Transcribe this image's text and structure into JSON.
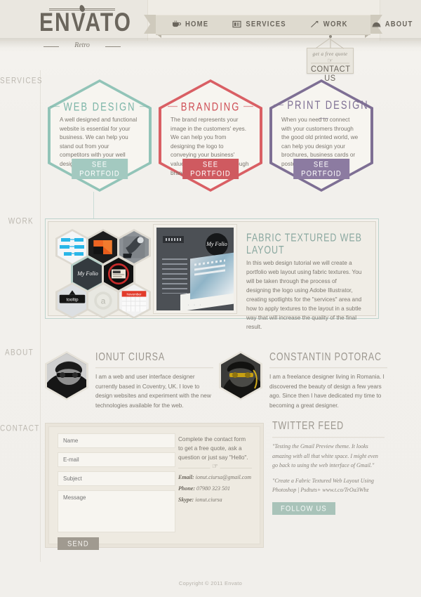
{
  "brand": {
    "name": "ENVATO",
    "tagline": "Retro",
    "bean_icon": "coffee-bean-icon"
  },
  "nav": {
    "items": [
      {
        "label": "HOME",
        "icon": "coffee-cup-icon"
      },
      {
        "label": "SERVICES",
        "icon": "book-icon"
      },
      {
        "label": "WORK",
        "icon": "hammer-icon"
      },
      {
        "label": "ABOUT",
        "icon": "hard-hat-icon"
      }
    ]
  },
  "contact_tag": {
    "quote": "get a free quote",
    "hand_icon": "pointing-hand-icon",
    "label": "CONTACT US"
  },
  "sidebar": {
    "labels": [
      "SERVICES",
      "WORK",
      "ABOUT",
      "CONTACT"
    ]
  },
  "services": [
    {
      "title": "WEB DESIGN",
      "body": "A well designed and functional website is essential for your business. We can help you stand out from your competitors with your well designed, custom website.",
      "button": "SEE PORTFOID",
      "color": "#92c4b8",
      "button_color": "#a3c9c0",
      "title_color": "#7cb5a8"
    },
    {
      "title": "BRANDING",
      "body": "The brand represents your image in the customers' eyes. We can help you from designing the logo to conveying your business' values and personality through branding.",
      "button": "SEE PORTFOID",
      "color": "#d95f64",
      "button_color": "#cf5a60",
      "title_color": "#cf4f56"
    },
    {
      "title": "PRINT DESIGN",
      "body": "When you need to connect with your customers through the good old printed world, we can help you design your brochures, business cards or posters.",
      "button": "SEE PORTFOID",
      "color": "#7e6f94",
      "button_color": "#8c7ba1",
      "title_color": "#7e6f94"
    }
  ],
  "work": {
    "title": "FABRIC TEXTURED WEB LAYOUT",
    "body": "In this web design tutorial we will create a portfolio web layout using fabric textures. You will be taken through the process of designing the logo using Adobe Illustrator, creating spotlights for the \"services\" area and how to apply textures to the layout in a subtle way that will increase the quality of the final result.",
    "thumbs": [
      {
        "name": "flowchart-thumb",
        "label": ""
      },
      {
        "name": "orange-cube-thumb",
        "label": ""
      },
      {
        "name": "gray-arm-thumb",
        "label": ""
      },
      {
        "name": "my-folio-thumb",
        "label": "My Folio"
      },
      {
        "name": "red-ring-thumb",
        "label": ""
      },
      {
        "name": "tooltip-thumb",
        "label": "tooltip"
      },
      {
        "name": "envato-a-thumb",
        "label": "a"
      },
      {
        "name": "calendar-thumb",
        "label": "November"
      }
    ],
    "preview": {
      "nav_label": "SERVICES",
      "badge": "My Folio",
      "dots": "· · ·"
    },
    "accent": "#8aa8a0"
  },
  "about": [
    {
      "name": "IONUT CIURSA",
      "bio": "I am a web and user interface designer currently based in Coventry, UK. I love to design websites and experiment with the new technologies available for the web.",
      "avatar": "ionut-avatar"
    },
    {
      "name": "CONSTANTIN POTORAC",
      "bio": "I am a freelance designer living in Romania. I discovered the beauty of design a few years ago. Since then I have dedicated my time to becoming a great designer.",
      "avatar": "constantin-avatar"
    }
  ],
  "contact": {
    "fields": {
      "name": "Name",
      "email": "E-mail",
      "subject": "Subject",
      "message": "Message"
    },
    "send_label": "SEND",
    "lead": "Complete the contact form to get a free quote, ask a question or just say \"Hello\".",
    "email_label": "Email:",
    "email_value": "ionut.ciursa@gmail.com",
    "phone_label": "Phone:",
    "phone_value": "07980 323 501",
    "skype_label": "Skype:",
    "skype_value": "ionut.ciursa"
  },
  "twitter": {
    "title": "TWITTER FEED",
    "tweets": [
      "\"Testing the Gmail Preview theme. It looks amazing with all that white space. I might even go back to using the web interface of Gmail.\"",
      "\"Create a Fabric Textured Web Layout Using Photoshop | Psdtuts+ www.t.co/TrOa3Wbz"
    ],
    "follow_label": "FOLLOW US",
    "accent": "#a9c3b9"
  },
  "footer": {
    "copyright": "Copyright © 2011 Envato"
  }
}
